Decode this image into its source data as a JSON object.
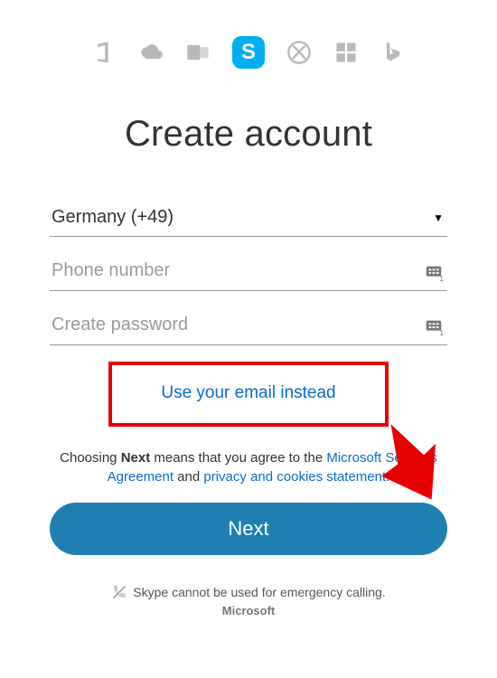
{
  "brand_row": {
    "icons": [
      "office-icon",
      "onedrive-icon",
      "outlook-icon",
      "skype-icon",
      "xbox-icon",
      "windows-icon",
      "bing-icon"
    ]
  },
  "title": "Create account",
  "country_select": {
    "selected_label": "Germany (+49)"
  },
  "phone": {
    "placeholder": "Phone number",
    "value": ""
  },
  "password": {
    "placeholder": "Create password",
    "value": ""
  },
  "use_email_link": "Use your email instead",
  "legal": {
    "prefix": "Choosing ",
    "bold": "Next",
    "mid": " means that you agree to the ",
    "link1": "Microsoft Services Agreement",
    "sep": " and ",
    "link2": "privacy and cookies statement",
    "suffix": "."
  },
  "next_button": "Next",
  "footer": {
    "emergency": "Skype cannot be used for emergency calling.",
    "brand": "Microsoft"
  }
}
